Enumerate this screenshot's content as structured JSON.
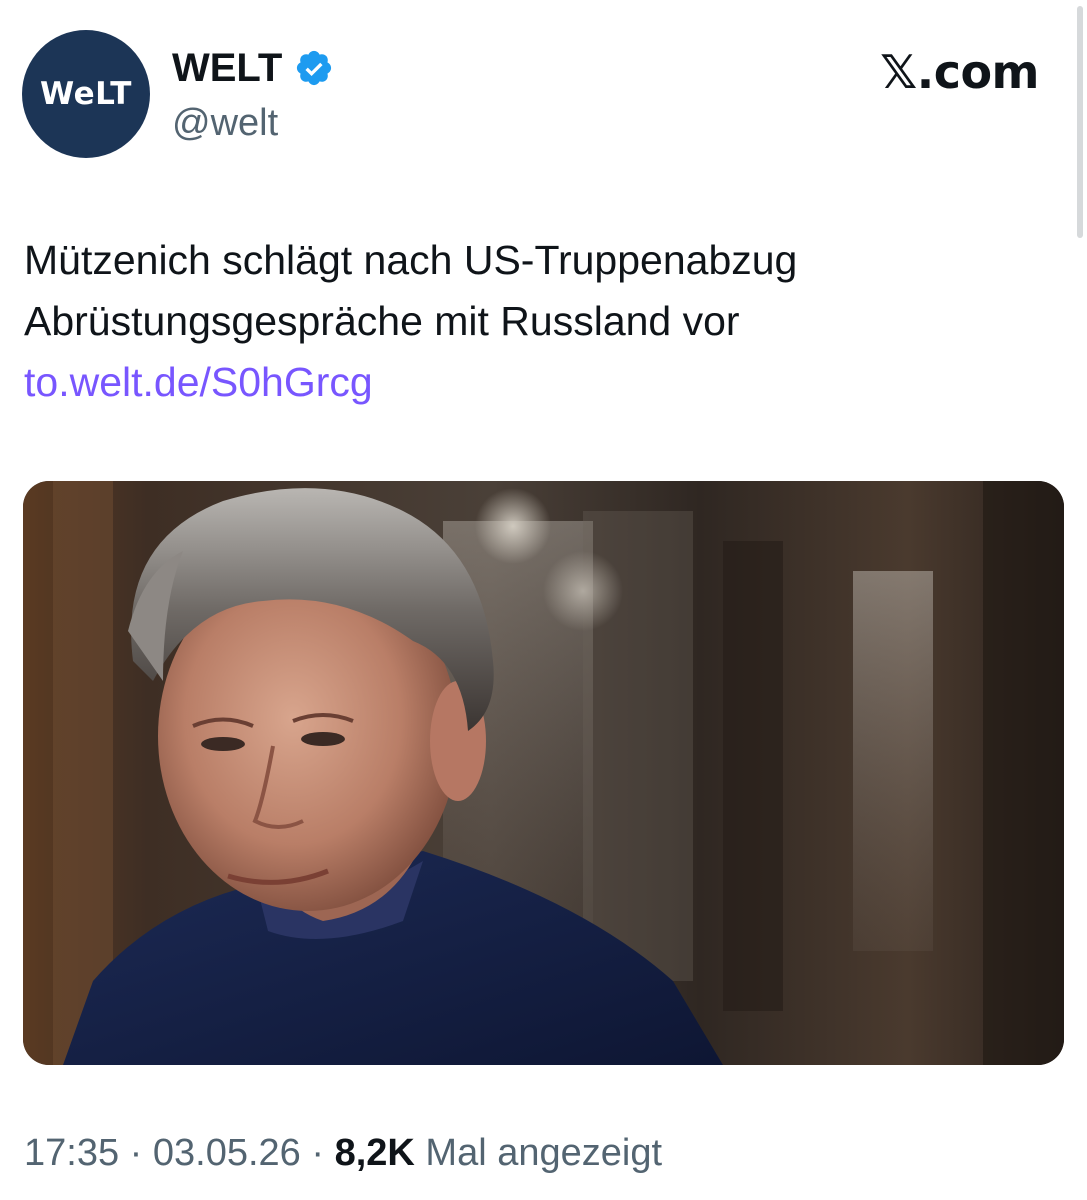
{
  "account": {
    "avatar_text": "WeLT",
    "display_name": "WELT",
    "handle": "@welt",
    "verified_icon": "verified-badge-icon",
    "avatar_color": "#1c3556",
    "verified_color": "#1d9bf0"
  },
  "source": {
    "label": "𝕏.com"
  },
  "tweet": {
    "text_line1": "Mützenich schlägt nach US-Truppenabzug",
    "text_line2": "Abrüstungsgespräche mit Russland vor",
    "link_text": "to.welt.de/S0hGrcg",
    "link_color": "#7856ff"
  },
  "meta": {
    "time": "17:35",
    "separator1": " · ",
    "date": "03.05.26",
    "separator2": " · ",
    "views_count": "8,2K",
    "views_label": " Mal angezeigt"
  },
  "media": {
    "icon": "photo-portrait"
  }
}
